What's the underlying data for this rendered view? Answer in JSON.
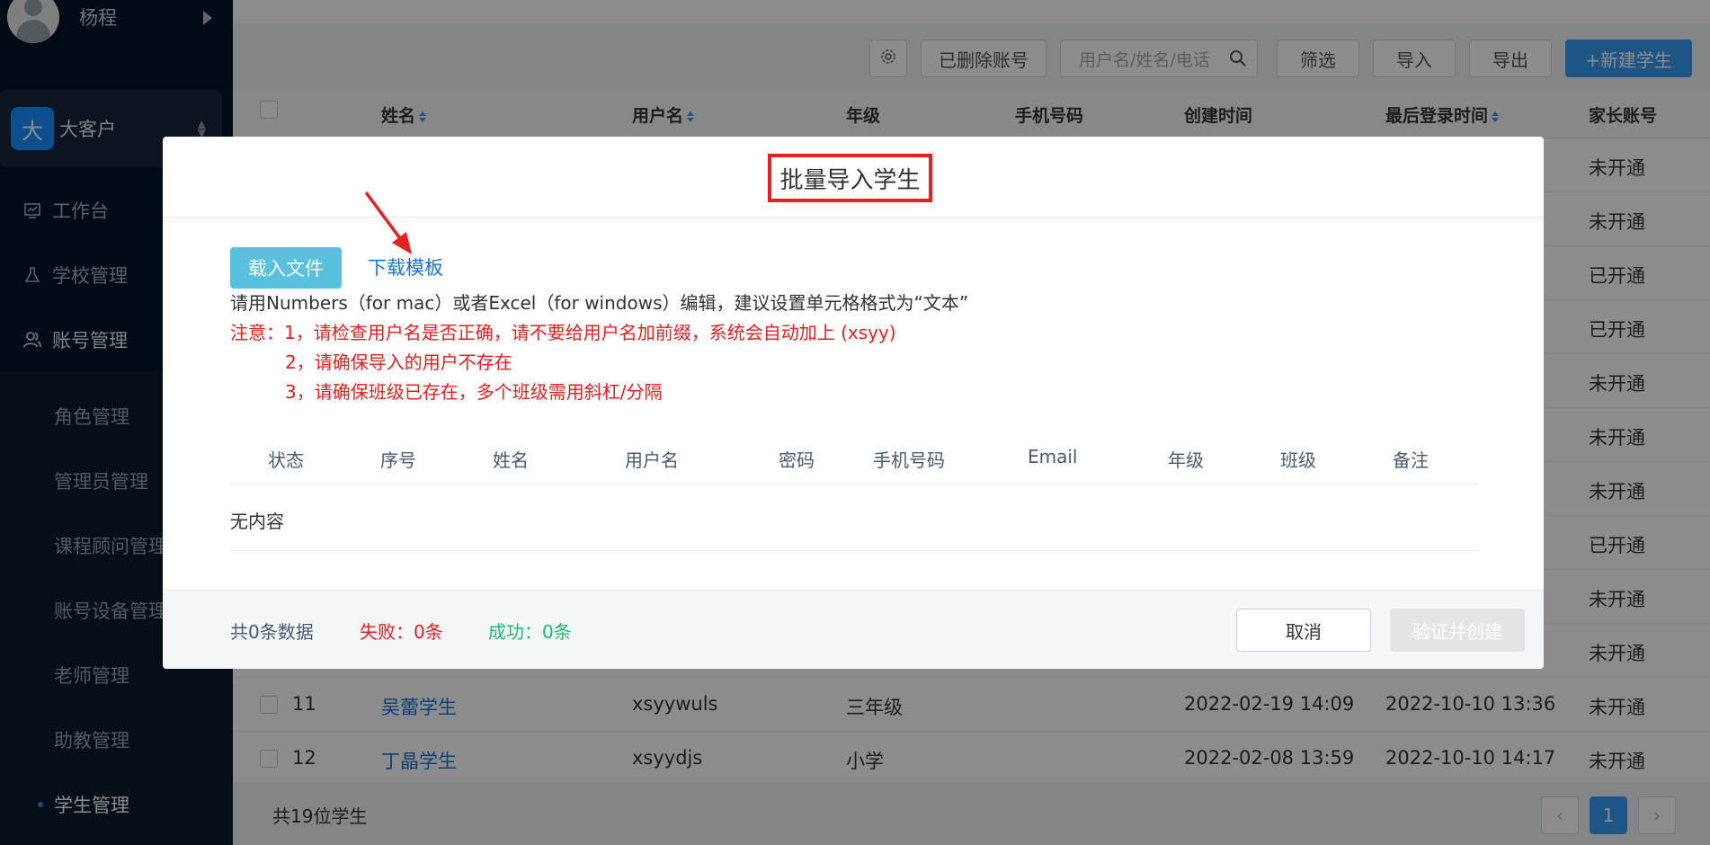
{
  "user": {
    "name": "杨程"
  },
  "tenant": {
    "badge": "大",
    "name": "大客户"
  },
  "nav": {
    "workbench": "工作台",
    "school": "学校管理",
    "account": "账号管理",
    "sub_items": [
      "角色管理",
      "管理员管理",
      "课程顾问管理",
      "账号设备管理",
      "老师管理",
      "助教管理",
      "学生管理"
    ]
  },
  "toolbar": {
    "deleted": "已删除账号",
    "search_placeholder": "用户名/姓名/电话",
    "filter": "筛选",
    "import": "导入",
    "export": "导出",
    "new_student": "+新建学生"
  },
  "table": {
    "headers": [
      "姓名",
      "用户名",
      "年级",
      "手机号码",
      "创建时间",
      "最后登录时间",
      "家长账号"
    ],
    "parent_status_visible": [
      "未开通",
      "未开通",
      "已开通",
      "已开通",
      "未开通",
      "未开通",
      "未开通",
      "已开通",
      "未开通",
      "未开通"
    ],
    "rows": [
      {
        "no": "11",
        "name": "吴蕾学生",
        "username": "xsyywuls",
        "grade": "三年级",
        "created": "2022-02-19 14:09",
        "last_login": "2022-10-10 13:36",
        "parent": "未开通"
      },
      {
        "no": "12",
        "name": "丁晶学生",
        "username": "xsyydjs",
        "grade": "小学",
        "created": "2022-02-08 13:59",
        "last_login": "2022-10-10 14:17",
        "parent": "未开通"
      }
    ],
    "total": "共19位学生",
    "page": "1"
  },
  "modal": {
    "title": "批量导入学生",
    "load_file": "载入文件",
    "download_template": "下载模板",
    "hint": "请用Numbers（for mac）或者Excel（for windows）编辑，建议设置单元格格式为“文本”",
    "note1": "注意：1，请检查用户名是否正确，请不要给用户名加前缀，系统会自动加上 (xsyy)",
    "note2": "2，请确保导入的用户不存在",
    "note3": "3，请确保班级已存在，多个班级需用斜杠/分隔",
    "columns": [
      "状态",
      "序号",
      "姓名",
      "用户名",
      "密码",
      "手机号码",
      "Email",
      "年级",
      "班级",
      "备注"
    ],
    "empty": "无内容",
    "total": "共0条数据",
    "failed": "失败：0条",
    "success": "成功：0条",
    "cancel": "取消",
    "verify": "验证并创建"
  },
  "colors": {
    "primary": "#3a9cf5",
    "danger": "#e52020",
    "success": "#19be6b",
    "sidebar": "#001529"
  }
}
